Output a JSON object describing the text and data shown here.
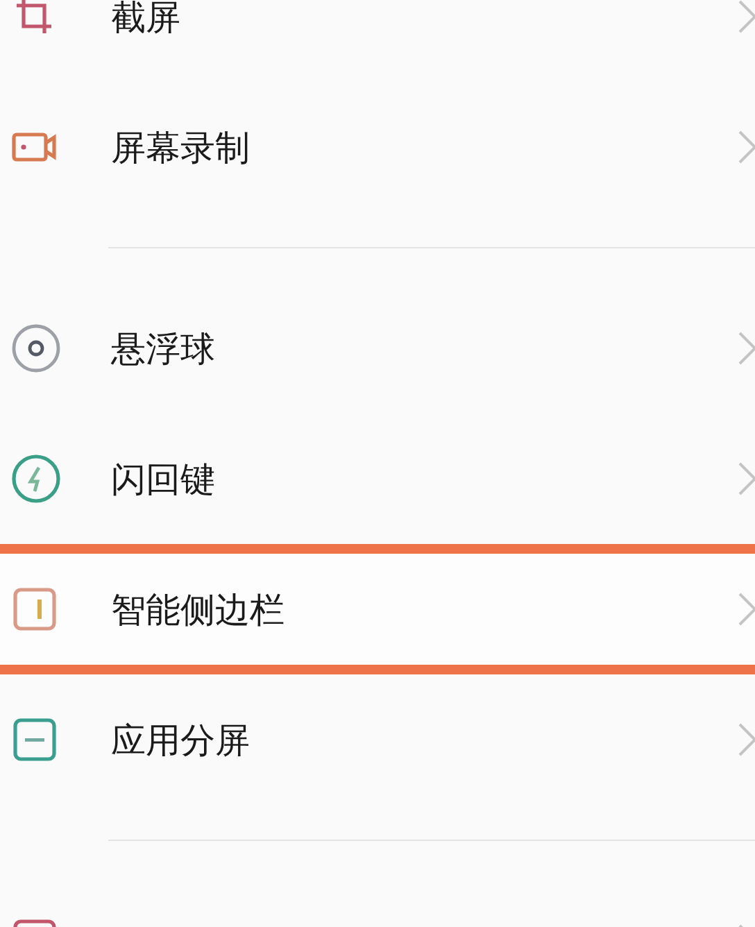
{
  "sections": [
    {
      "items": [
        {
          "kind": "crop",
          "label": "截屏",
          "highlighted": false
        },
        {
          "kind": "video",
          "label": "屏幕录制",
          "highlighted": false
        }
      ]
    },
    {
      "items": [
        {
          "kind": "ball",
          "label": "悬浮球",
          "highlighted": false
        },
        {
          "kind": "flash",
          "label": "闪回键",
          "highlighted": false
        },
        {
          "kind": "sidebar",
          "label": "智能侧边栏",
          "highlighted": true
        },
        {
          "kind": "split",
          "label": "应用分屏",
          "highlighted": false
        }
      ]
    },
    {
      "items": [
        {
          "kind": "square",
          "highlighted": false
        }
      ]
    }
  ]
}
